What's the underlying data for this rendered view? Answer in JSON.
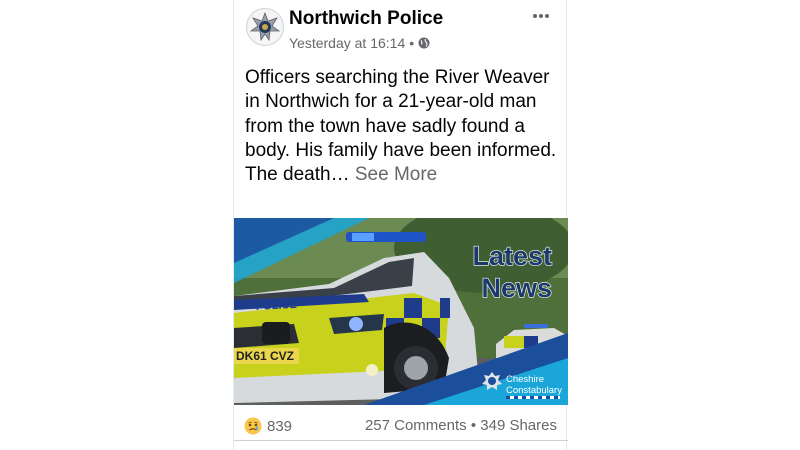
{
  "post": {
    "page_name": "Northwich Police",
    "timestamp": "Yesterday at 16:14",
    "separator": "•",
    "audience_icon": "globe-icon",
    "more_icon": "ellipsis-icon",
    "text": "Officers searching the River Weaver in Northwich for a 21-year-old man from the town have sadly found a body. His family have been informed.",
    "text_continuation": "The death…",
    "see_more": "See More"
  },
  "image": {
    "headline_line1": "Latest",
    "headline_line2": "News",
    "plate": "DK61 CVZ",
    "livery_text": "POLICE",
    "brand_line1": "Cheshire",
    "brand_line2": "Constabulary",
    "colors": {
      "headline_fill": "#1b3a6b",
      "livery_yellow": "#d6e01a",
      "livery_blue": "#1f3c8c",
      "accent_cyan": "#1aa6d9"
    }
  },
  "footer": {
    "reaction_icon": "sad-face-icon",
    "reaction_count": "839",
    "comments": "257 Comments",
    "separator": "•",
    "shares": "349 Shares"
  }
}
